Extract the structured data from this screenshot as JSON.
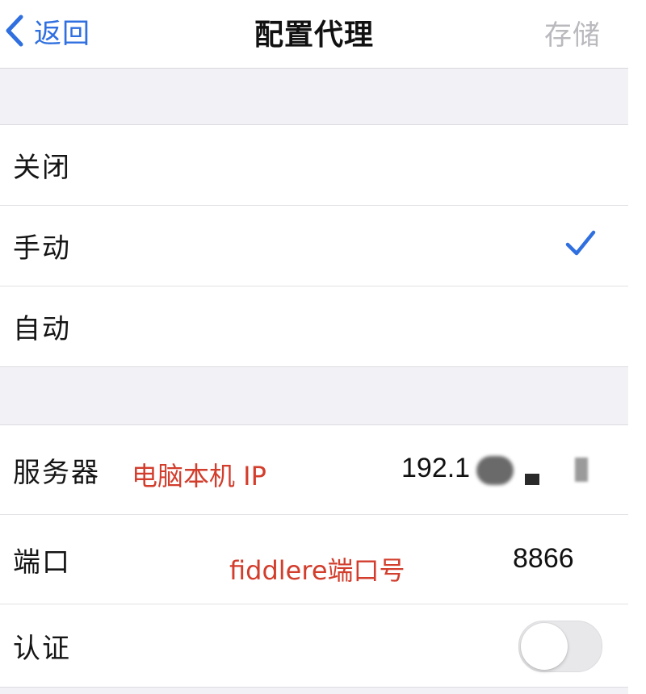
{
  "navbar": {
    "back_label": "返回",
    "title": "配置代理",
    "save_label": "存储"
  },
  "mode_options": [
    {
      "label": "关闭",
      "selected": false
    },
    {
      "label": "手动",
      "selected": true
    },
    {
      "label": "自动",
      "selected": false
    }
  ],
  "manual_settings": {
    "server": {
      "label": "服务器",
      "annotation": "电脑本机 IP",
      "value": "192.1"
    },
    "port": {
      "label": "端口",
      "annotation": "fiddlere端口号",
      "value": "8866"
    },
    "auth": {
      "label": "认证",
      "enabled": false
    }
  },
  "colors": {
    "accent": "#2f6fe0",
    "annotation": "#d23d2c",
    "save_disabled": "#b9b9be",
    "background": "#f1f1f6"
  }
}
